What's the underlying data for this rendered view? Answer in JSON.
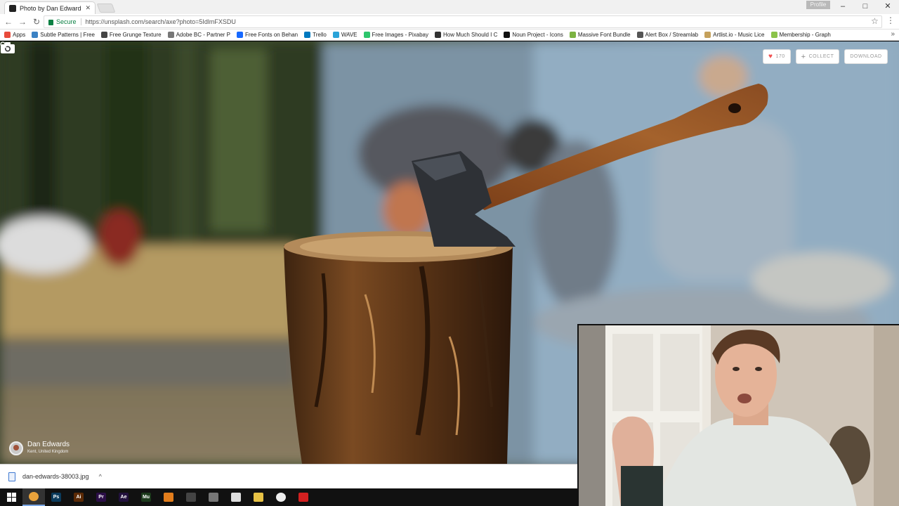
{
  "browser": {
    "tab_title": "Photo by Dan Edwards (",
    "tab_close": "✕",
    "profile_label": "Profile",
    "window_controls": [
      "–",
      "□",
      "✕"
    ],
    "nav": {
      "back": "←",
      "forward": "→",
      "reload": "↻"
    },
    "secure_label": "Secure",
    "url": "https://unsplash.com/search/axe?photo=5IdlmFXSDU",
    "bookmarks_more": "»",
    "bookmarks": [
      {
        "label": "Apps",
        "color": "#e84b3c"
      },
      {
        "label": "Subtle Patterns | Free",
        "color": "#3b82c4"
      },
      {
        "label": "Free Grunge Texture",
        "color": "#444444"
      },
      {
        "label": "Adobe BC - Partner P",
        "color": "#777777"
      },
      {
        "label": "Free Fonts on Behan",
        "color": "#1769ff"
      },
      {
        "label": "Trello",
        "color": "#0079bf"
      },
      {
        "label": "WAVE",
        "color": "#2aa3d8"
      },
      {
        "label": "Free Images - Pixabay",
        "color": "#2ec66d"
      },
      {
        "label": "How Much Should I C",
        "color": "#333333"
      },
      {
        "label": "Noun Project - Icons",
        "color": "#111111"
      },
      {
        "label": "Massive Font Bundle",
        "color": "#7cb342"
      },
      {
        "label": "Alert Box / Streamlab",
        "color": "#555555"
      },
      {
        "label": "Artlist.io - Music Lice",
        "color": "#c5a15c"
      },
      {
        "label": "Membership - Graph",
        "color": "#8bc34a"
      }
    ]
  },
  "unsplash": {
    "like_count": "170",
    "collect_label": "COLLECT",
    "download_label": "DOWNLOAD",
    "photographer_name": "Dan Edwards",
    "photographer_location": "Kent, United Kingdom"
  },
  "downloads": {
    "file_name": "dan-edwards-38003.jpg",
    "chevron": "^"
  },
  "taskbar": {
    "apps": [
      {
        "name": "chrome",
        "color": "#e9a23b",
        "label": ""
      },
      {
        "name": "photoshop",
        "color": "#0b3b5c",
        "label": "Ps"
      },
      {
        "name": "illustrator",
        "color": "#5b2a06",
        "label": "Ai"
      },
      {
        "name": "premiere",
        "color": "#2b0e46",
        "label": "Pr"
      },
      {
        "name": "after-effects",
        "color": "#22113d",
        "label": "Ae"
      },
      {
        "name": "muse",
        "color": "#1c3a1c",
        "label": "Mu"
      },
      {
        "name": "vlc",
        "color": "#e27d1c",
        "label": ""
      },
      {
        "name": "settings",
        "color": "#444444",
        "label": ""
      },
      {
        "name": "photos",
        "color": "#777777",
        "label": ""
      },
      {
        "name": "mail",
        "color": "#dddddd",
        "label": ""
      },
      {
        "name": "file-explorer",
        "color": "#e7c245",
        "label": ""
      },
      {
        "name": "obs",
        "color": "#eeeeee",
        "label": ""
      },
      {
        "name": "screen-recorder",
        "color": "#d32020",
        "label": ""
      }
    ]
  }
}
